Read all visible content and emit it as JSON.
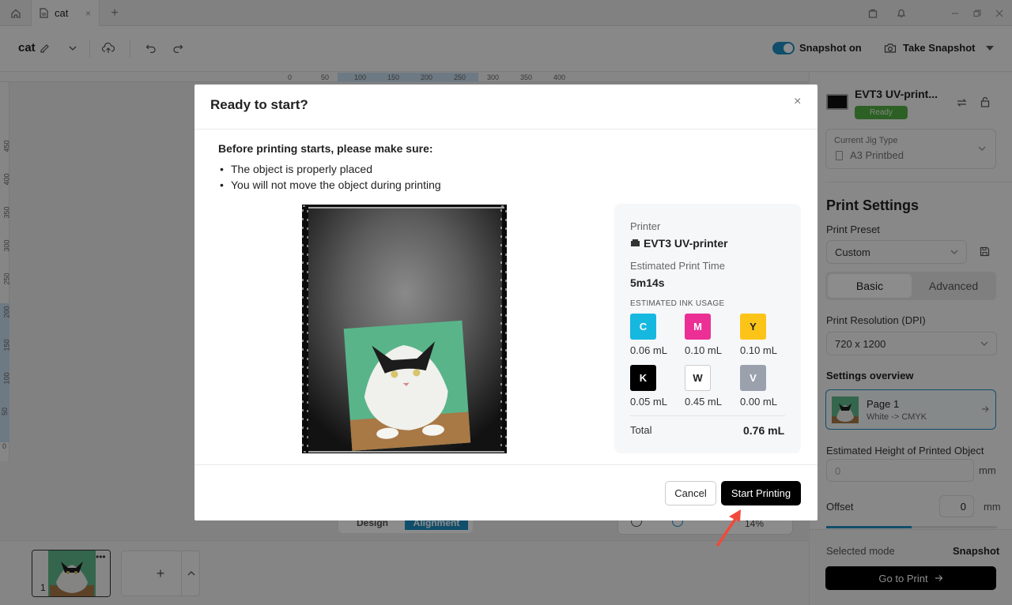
{
  "window": {
    "tab_label": "cat",
    "tab_close": "×",
    "new_tab": "+"
  },
  "toolbar": {
    "project_name": "cat",
    "snapshot_toggle_label": "Snapshot on",
    "take_snapshot_label": "Take Snapshot"
  },
  "ruler": {
    "top": [
      "0",
      "50",
      "100",
      "150",
      "200",
      "250",
      "300",
      "350",
      "400"
    ],
    "left": [
      "450",
      "400",
      "350",
      "300",
      "250",
      "200",
      "150",
      "100",
      "50",
      "0"
    ]
  },
  "canvas": {
    "design_tab": "Design",
    "alignment_tab": "Alignment",
    "zoom": "14%"
  },
  "pages": {
    "thumb_number": "1",
    "add_label": "+"
  },
  "right_panel": {
    "printer_name": "EVT3 UV-print...",
    "status": "Ready",
    "jig_label": "Current Jig Type",
    "jig_value": "A3 Printbed",
    "print_settings_title": "Print Settings",
    "preset_label": "Print Preset",
    "preset_value": "Custom",
    "tab_basic": "Basic",
    "tab_advanced": "Advanced",
    "resolution_label": "Print Resolution (DPI)",
    "resolution_value": "720 x 1200",
    "overview_label": "Settings overview",
    "page_name": "Page 1",
    "page_mode": "White -> CMYK",
    "height_label": "Estimated Height of Printed Object",
    "height_placeholder": "0",
    "height_unit": "mm",
    "offset_label": "Offset",
    "offset_value": "0",
    "offset_unit": "mm",
    "selected_mode_label": "Selected mode",
    "selected_mode_value": "Snapshot",
    "go_print_label": "Go to Print"
  },
  "modal": {
    "title": "Ready to start?",
    "close": "×",
    "subtitle": "Before printing starts, please make sure:",
    "bullets": [
      "The object is properly placed",
      "You will not move the object during printing"
    ],
    "printer_label": "Printer",
    "printer_name": "EVT3 UV-printer",
    "time_label": "Estimated Print Time",
    "time_value": "5m14s",
    "ink_label": "ESTIMATED INK USAGE",
    "inks": [
      {
        "letter": "C",
        "value": "0.06 mL",
        "color": "#16b8e0"
      },
      {
        "letter": "M",
        "value": "0.10 mL",
        "color": "#ec2f95"
      },
      {
        "letter": "Y",
        "value": "0.10 mL",
        "color": "#fcc419"
      },
      {
        "letter": "K",
        "value": "0.05 mL",
        "color": "#000000"
      },
      {
        "letter": "W",
        "value": "0.45 mL",
        "color": "#ffffff"
      },
      {
        "letter": "V",
        "value": "0.00 mL",
        "color": "#9aa1ad"
      }
    ],
    "total_label": "Total",
    "total_value": "0.76 mL",
    "cancel_label": "Cancel",
    "start_label": "Start Printing"
  },
  "colors": {
    "accent": "#1f8fc4",
    "ready_green": "#52b043",
    "pointer_arrow": "#f04a3a"
  }
}
